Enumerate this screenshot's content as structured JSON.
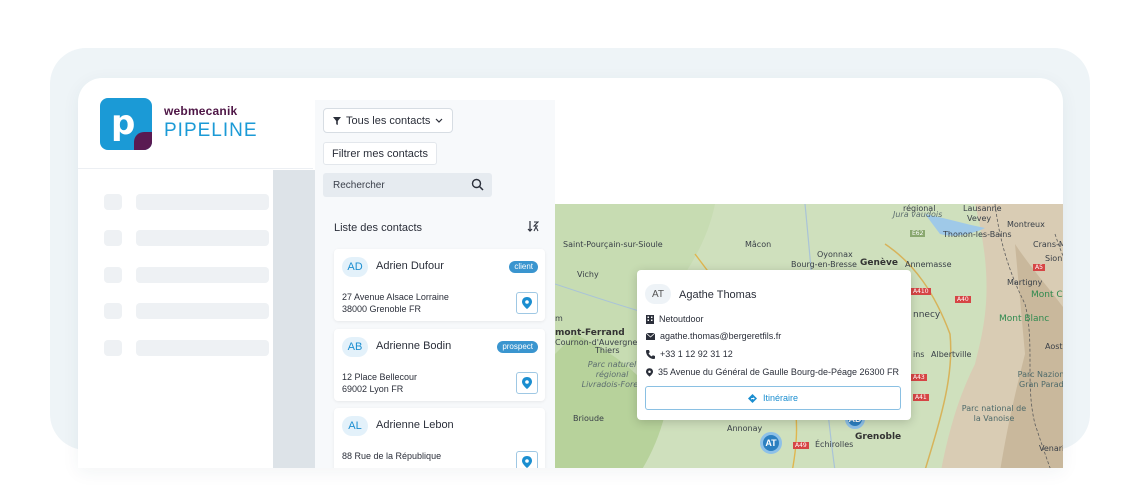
{
  "brand": {
    "top": "webmecanik",
    "bottom": "PIPELINE"
  },
  "filter": {
    "label": "Tous les contacts",
    "mine_label": "Filtrer mes contacts"
  },
  "search": {
    "placeholder": "Rechercher"
  },
  "list": {
    "title": "Liste des contacts",
    "contacts": [
      {
        "initials": "AD",
        "name": "Adrien Dufour",
        "badge": "client",
        "line1": "27 Avenue Alsace Lorraine",
        "line2": "38000 Grenoble FR"
      },
      {
        "initials": "AB",
        "name": "Adrienne Bodin",
        "badge": "prospect",
        "line1": "12 Place Bellecour",
        "line2": "69002 Lyon FR"
      },
      {
        "initials": "AL",
        "name": "Adrienne Lebon",
        "badge": "",
        "line1": "88 Rue de la République",
        "line2": ""
      }
    ]
  },
  "popup": {
    "initials": "AT",
    "name": "Agathe Thomas",
    "company": "Netoutdoor",
    "email": "agathe.thomas@bergeretfils.fr",
    "phone": "+33 1 12 92 31 12",
    "address": "35 Avenue du Général de Gaulle Bourg-de-Péage 26300 FR",
    "button": "Itinéraire"
  },
  "map": {
    "labels": {
      "saint_pourcain": "Saint-Pourçain-sur-Sioule",
      "macon": "Mâcon",
      "vichy": "Vichy",
      "oyonnax": "Oyonnax",
      "bourg": "Bourg-en-Bresse",
      "geneve": "Genève",
      "annemasse": "Annemasse",
      "lausanne": "Lausanne",
      "jura": "Jura vaudois",
      "vevey": "Vevey",
      "montreux": "Montreux",
      "thonon": "Thonon-les-Bains",
      "crans": "Crans-Montana",
      "sion": "Sion",
      "martigny": "Martigny",
      "mont_cervin": "Mont Cervin",
      "annecy": "nnecy",
      "mont_blanc": "Mont Blanc",
      "aoste": "Aoste",
      "albertville": "Albertville",
      "thiers": "Thiers",
      "clermont": "mont-Ferrand",
      "cournon": "Cournon-d'Auvergne",
      "parc_livradois": "Parc naturel régional Livradois-Forez",
      "brioude": "Brioude",
      "annonay": "Annonay",
      "echirolles": "Échirolles",
      "grenoble": "Grenoble",
      "parc_paradiso": "Parc Nazionale Gran Paradiso",
      "parc_vanoise": "Parc national de la Vanoise",
      "venaria": "Venaria Rea",
      "fragment_m": "m",
      "fragment_ins": "ins",
      "fragment_regional": "régional",
      "a40": "A40",
      "a41": "A41",
      "a43": "A43",
      "a49": "A49",
      "e62": "E62",
      "a410": "A410",
      "a5": "A5"
    },
    "clusters": [
      "AT",
      "AD"
    ]
  },
  "icons": {
    "filter": "filter-funnel-icon",
    "chevron": "chevron-down-icon",
    "search": "search-icon",
    "sort": "sort-alpha-icon",
    "pin": "map-pin-icon",
    "building": "building-icon",
    "mail": "envelope-icon",
    "phone": "phone-icon",
    "directions": "directions-icon"
  },
  "colors": {
    "accent": "#1b9ad6",
    "brand_dark": "#4e1646",
    "badge": "#3a95cf"
  }
}
